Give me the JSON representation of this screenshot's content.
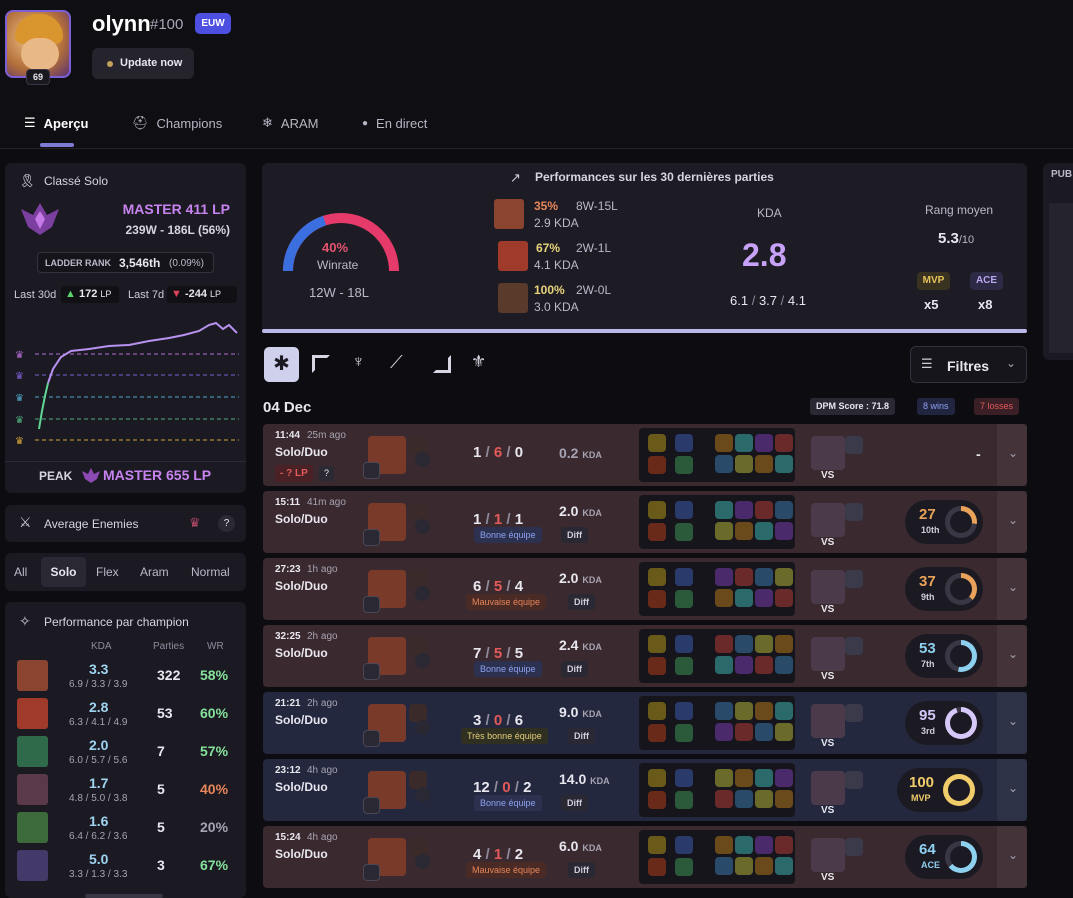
{
  "profile": {
    "name": "olynn",
    "tag": "#100",
    "region": "EUW",
    "level": "69",
    "update_label": "Update now"
  },
  "tabs": [
    "Aperçu",
    "Champions",
    "ARAM",
    "En direct"
  ],
  "ranked": {
    "title": "Classé Solo",
    "tier": "MASTER 411 LP",
    "record": "239W - 186L (56%)",
    "ladder_label": "LADDER RANK",
    "ladder_value": "3,546th",
    "ladder_pct": "(0.09%)",
    "last30_label": "Last 30d",
    "last30_value": "172",
    "last7_label": "Last 7d",
    "last7_value": "-244",
    "lp_unit": "LP",
    "peak_label": "PEAK",
    "peak_value": "MASTER 655 LP"
  },
  "avg_enemies": {
    "title": "Average Enemies",
    "help": "?"
  },
  "queue_filters": [
    "All",
    "Solo",
    "Flex",
    "Aram",
    "Normal"
  ],
  "perf_champ": {
    "title": "Performance par champion",
    "headers": [
      "KDA",
      "Parties",
      "WR"
    ],
    "rows": [
      {
        "kda": "3.3",
        "detail": "6.9 / 3.3 / 3.9",
        "games": "322",
        "wr": "58%",
        "color": "#86e29b"
      },
      {
        "kda": "2.8",
        "detail": "6.3 / 4.1 / 4.9",
        "games": "53",
        "wr": "60%",
        "color": "#86e29b"
      },
      {
        "kda": "2.0",
        "detail": "6.0 / 5.7 / 5.6",
        "games": "7",
        "wr": "57%",
        "color": "#86e29b"
      },
      {
        "kda": "1.7",
        "detail": "4.8 / 5.0 / 3.8",
        "games": "5",
        "wr": "40%",
        "color": "#e8865a"
      },
      {
        "kda": "1.6",
        "detail": "6.4 / 6.2 / 3.6",
        "games": "5",
        "wr": "20%",
        "color": "#a7a3b2"
      },
      {
        "kda": "5.0",
        "detail": "3.3 / 1.3 / 3.3",
        "games": "3",
        "wr": "67%",
        "color": "#86e29b"
      }
    ]
  },
  "performance": {
    "title": "Performances sur les 30 dernières parties",
    "winrate": "40%",
    "winrate_label": "Winrate",
    "wl": "12W - 18L",
    "champs": [
      {
        "wr": "35%",
        "wl": "8W-15L",
        "kda": "2.9 KDA",
        "wr_color": "#e8865a"
      },
      {
        "wr": "67%",
        "wl": "2W-1L",
        "kda": "4.1 KDA",
        "wr_color": "#e8d37a"
      },
      {
        "wr": "100%",
        "wl": "2W-0L",
        "kda": "3.0 KDA",
        "wr_color": "#e8d37a"
      }
    ],
    "kda_label": "KDA",
    "kda_value": "2.8",
    "kda_detail": [
      "6.1",
      "3.7",
      "4.1"
    ],
    "rank_label": "Rang moyen",
    "rank_value": "5.3",
    "rank_max": "/10",
    "mvp_label": "MVP",
    "mvp_count": "x5",
    "ace_label": "ACE",
    "ace_count": "x8"
  },
  "filters_label": "Filtres",
  "date": "04 Dec",
  "dpm": "DPM Score : 71.8",
  "wins_label": "8 wins",
  "losses_label": "7 losses",
  "matches": [
    {
      "time": "11:44",
      "ago": "25m ago",
      "queue": "Solo/Duo",
      "k": "1",
      "d": "6",
      "a": "0",
      "kda": "0.2",
      "badge": "",
      "diff": "",
      "lp": "- ? LP",
      "score": "-",
      "rank": "",
      "result": "loss"
    },
    {
      "time": "15:11",
      "ago": "41m ago",
      "queue": "Solo/Duo",
      "k": "1",
      "d": "1",
      "a": "1",
      "kda": "2.0",
      "badge": "Bonne équipe",
      "diff": "Diff",
      "lp": "",
      "score": "27",
      "rank": "10th",
      "result": "loss"
    },
    {
      "time": "27:23",
      "ago": "1h ago",
      "queue": "Solo/Duo",
      "k": "6",
      "d": "5",
      "a": "4",
      "kda": "2.0",
      "badge": "Mauvaise équipe",
      "diff": "Diff",
      "lp": "",
      "score": "37",
      "rank": "9th",
      "result": "loss"
    },
    {
      "time": "32:25",
      "ago": "2h ago",
      "queue": "Solo/Duo",
      "k": "7",
      "d": "5",
      "a": "5",
      "kda": "2.4",
      "badge": "Bonne équipe",
      "diff": "Diff",
      "lp": "",
      "score": "53",
      "rank": "7th",
      "result": "loss"
    },
    {
      "time": "21:21",
      "ago": "2h ago",
      "queue": "Solo/Duo",
      "k": "3",
      "d": "0",
      "a": "6",
      "kda": "9.0",
      "badge": "Très bonne équipe",
      "diff": "Diff",
      "lp": "",
      "score": "95",
      "rank": "3rd",
      "result": "win"
    },
    {
      "time": "23:12",
      "ago": "4h ago",
      "queue": "Solo/Duo",
      "k": "12",
      "d": "0",
      "a": "2",
      "kda": "14.0",
      "badge": "Bonne équipe",
      "diff": "Diff",
      "lp": "",
      "score": "100",
      "rank": "MVP",
      "result": "win"
    },
    {
      "time": "15:24",
      "ago": "4h ago",
      "queue": "Solo/Duo",
      "k": "4",
      "d": "1",
      "a": "2",
      "kda": "6.0",
      "badge": "Mauvaise équipe",
      "diff": "Diff",
      "lp": "",
      "score": "64",
      "rank": "ACE",
      "result": "loss"
    }
  ],
  "kda_suffix": "KDA",
  "vs_label": "VS",
  "side_label": "PUB"
}
